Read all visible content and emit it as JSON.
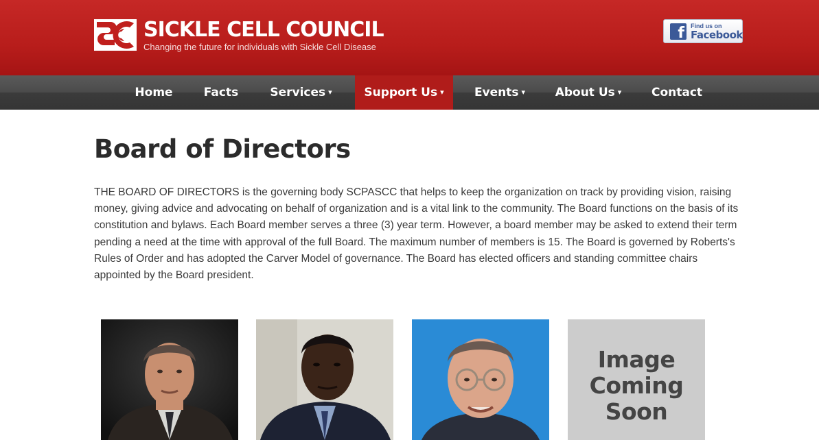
{
  "header": {
    "title": "SICKLE CELL COUNCIL",
    "tagline": "Changing the future for individuals with Sickle Cell Disease",
    "facebook": {
      "small": "Find us on",
      "big": "Facebook"
    }
  },
  "nav": {
    "items": [
      {
        "label": "Home"
      },
      {
        "label": "Facts"
      },
      {
        "label": "Services"
      },
      {
        "label": "Support Us"
      },
      {
        "label": "Events"
      },
      {
        "label": "About Us"
      },
      {
        "label": "Contact"
      }
    ],
    "caret": "▾",
    "active": "Support Us",
    "active_color": "#b01c1a"
  },
  "main": {
    "title": "Board of Directors",
    "intro": "THE BOARD OF DIRECTORS is the governing body SCPASCC that helps to keep the organization on track by providing vision, raising money, giving advice and advocating on behalf of organization and is a vital link to the community. The Board functions on the basis of its constitution and bylaws. Each Board member serves a three (3) year term. However, a board member may be asked to extend their term pending a need at the time with approval of the full Board. The maximum number of members is 15. The Board is governed by Roberts's Rules of Order and has adopted the Carver Model of governance. The Board has elected officers and standing committee chairs appointed by the Board president."
  },
  "placeholder": {
    "line1": "Image",
    "line2": "Coming",
    "line3": "Soon"
  },
  "colors": {
    "header_red": "#b81d1b",
    "nav_gray": "#444444",
    "facebook_blue": "#3b5998"
  }
}
